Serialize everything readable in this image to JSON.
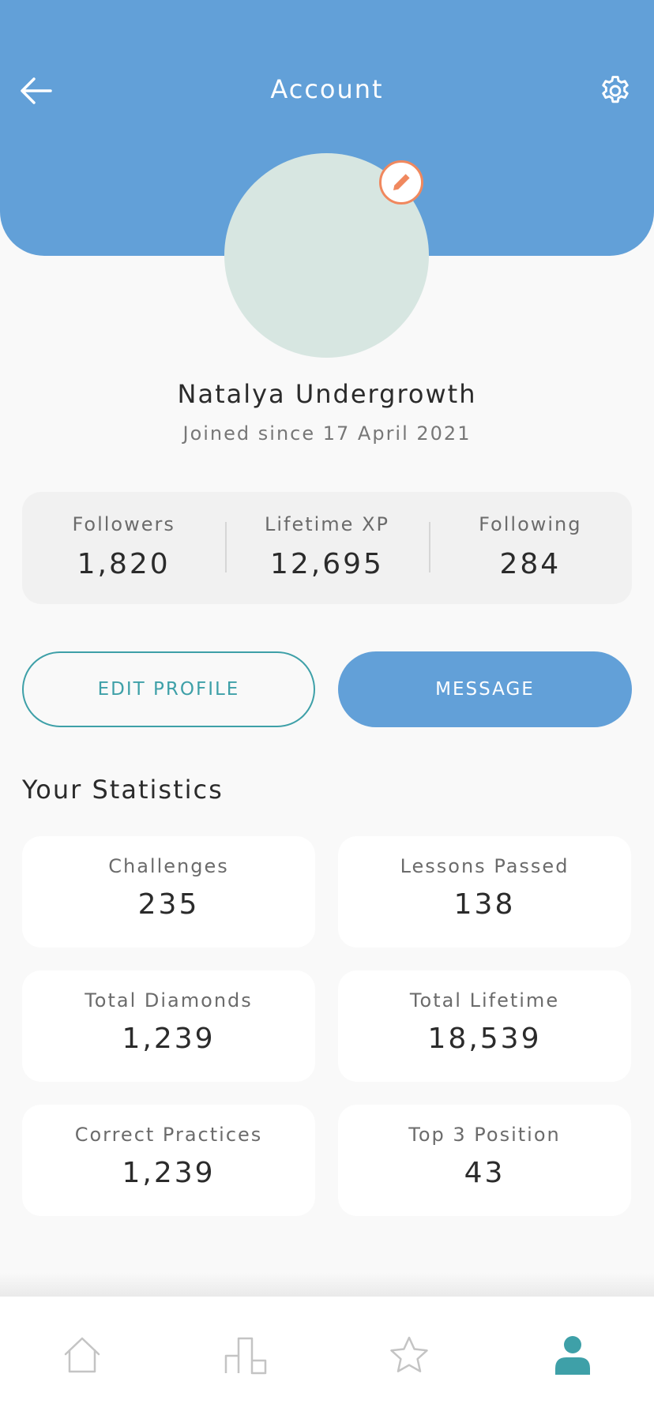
{
  "header": {
    "title": "Account",
    "back_icon": "arrow-left-icon",
    "settings_icon": "gear-icon",
    "background_color": "#62a0d8"
  },
  "profile": {
    "name": "Natalya Undergrowth",
    "joined": "Joined since 17 April 2021",
    "edit_icon": "pencil-icon",
    "avatar_color": "#d7e6e1",
    "edit_accent_color": "#f0885e"
  },
  "counts": [
    {
      "label": "Followers",
      "value": "1,820"
    },
    {
      "label": "Lifetime XP",
      "value": "12,695"
    },
    {
      "label": "Following",
      "value": "284"
    }
  ],
  "actions": {
    "edit_profile_label": "EDIT PROFILE",
    "message_label": "MESSAGE",
    "outline_color": "#3ea0a8",
    "primary_color": "#62a0d8"
  },
  "statistics": {
    "heading": "Your Statistics",
    "cards": [
      {
        "label": "Challenges",
        "value": "235"
      },
      {
        "label": "Lessons Passed",
        "value": "138"
      },
      {
        "label": "Total Diamonds",
        "value": "1,239"
      },
      {
        "label": "Total Lifetime",
        "value": "18,539"
      },
      {
        "label": "Correct Practices",
        "value": "1,239"
      },
      {
        "label": "Top 3 Position",
        "value": "43"
      }
    ]
  },
  "bottom_nav": {
    "items": [
      {
        "icon": "home-icon",
        "active": false
      },
      {
        "icon": "leaderboard-icon",
        "active": false
      },
      {
        "icon": "star-icon",
        "active": false
      },
      {
        "icon": "profile-icon",
        "active": true
      }
    ],
    "active_color": "#3ea0a8",
    "inactive_color": "#c4c4c4"
  }
}
